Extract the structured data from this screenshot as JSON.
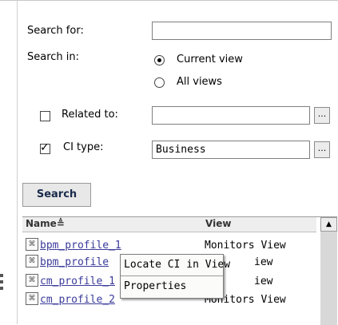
{
  "search_panel": {
    "search_for_label": "Search for:",
    "search_for_value": "",
    "search_in_label": "Search in:",
    "search_in_options": [
      "Current view",
      "All views"
    ],
    "search_in_selected": "Current view",
    "related_to_label": "Related to:",
    "related_to_checked": false,
    "related_to_value": "",
    "ci_type_label": "CI type:",
    "ci_type_checked": true,
    "ci_type_value": "Business",
    "browse_label": "...",
    "search_button": "Search"
  },
  "results": {
    "columns": [
      "Name",
      "View"
    ],
    "sort_icon": "sort-ascending-icon",
    "rows": [
      {
        "name": "bpm_profile_1",
        "view": "Monitors View"
      },
      {
        "name": "bpm_profile",
        "view": "iew"
      },
      {
        "name": "cm_profile_1",
        "view": "iew"
      },
      {
        "name": "cm_profile_2",
        "view": "Monitors View"
      }
    ]
  },
  "context_menu": {
    "items": [
      "Locate CI in View",
      "Properties"
    ]
  }
}
